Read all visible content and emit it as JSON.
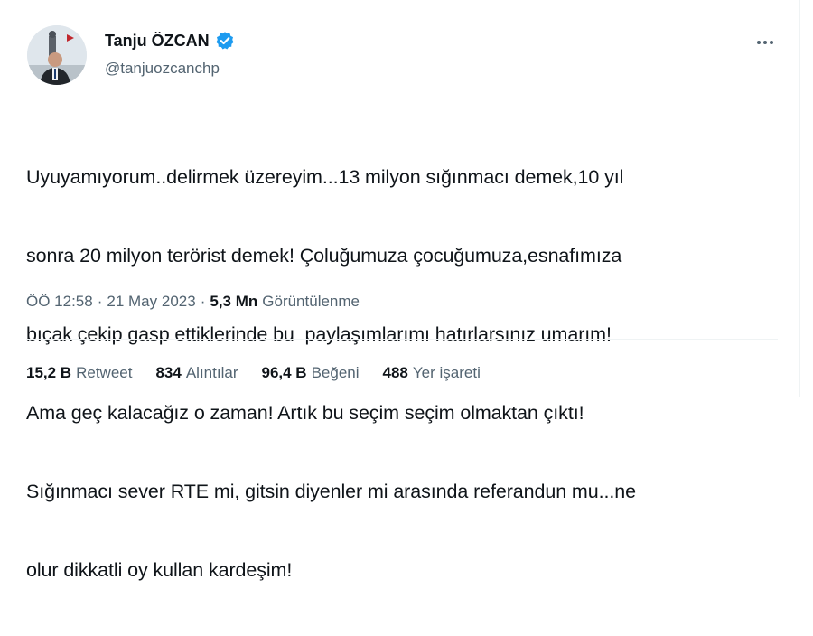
{
  "tweet": {
    "author": {
      "name": "Tanju ÖZCAN",
      "handle": "@tanjuozcanchp",
      "verified_icon": "verified-badge-icon",
      "verified_color": "#1d9bf0"
    },
    "more_icon": "more-options-icon",
    "text_lines": [
      "Uyuyamıyorum..delirmek üzereyim...13 milyon sığınmacı demek,10 yıl",
      "sonra 20 milyon terörist demek! Çoluğumuza çocuğumuza,esnafımıza",
      "bıçak çekip gasp ettiklerinde bu  paylaşımlarımı hatırlarsınız umarım!",
      "Ama geç kalacağız o zaman! Artık bu seçim seçim olmaktan çıktı!",
      "Sığınmacı sever RTE mi, gitsin diyenler mi arasında referandun mu...ne",
      "olur dikkatli oy kullan kardeşim!"
    ],
    "meta": {
      "time": "ÖÖ 12:58",
      "separator": "·",
      "date": "21 May 2023",
      "views_count": "5,3 Mn",
      "views_label": "Görüntülenme"
    },
    "stats": {
      "retweets": {
        "count": "15,2 B",
        "label": "Retweet"
      },
      "quotes": {
        "count": "834",
        "label": "Alıntılar"
      },
      "likes": {
        "count": "96,4 B",
        "label": "Beğeni"
      },
      "bookmarks": {
        "count": "488",
        "label": "Yer işareti"
      }
    }
  }
}
